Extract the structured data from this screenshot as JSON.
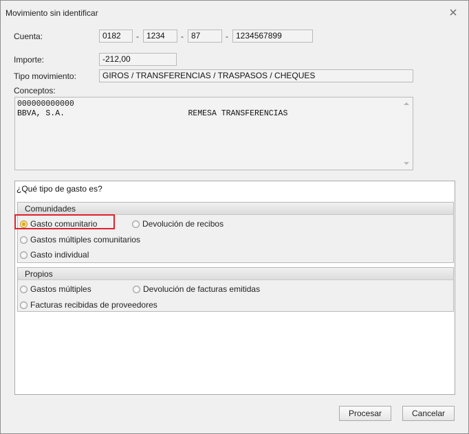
{
  "window": {
    "title": "Movimiento sin identificar"
  },
  "form": {
    "cuenta_label": "Cuenta:",
    "cuenta": [
      "0182",
      "1234",
      "87",
      "1234567899"
    ],
    "separator": "-",
    "importe_label": "Importe:",
    "importe": "-212,00",
    "tipo_label": "Tipo movimiento:",
    "tipo": "GIROS / TRANSFERENCIAS / TRASPASOS / CHEQUES",
    "conceptos_label": "Conceptos:",
    "conceptos_lines": [
      "000000000000",
      "BBVA, S.A.                          REMESA TRANSFERENCIAS"
    ]
  },
  "expense": {
    "question": "¿Qué tipo de gasto es?",
    "comunidades": {
      "title": "Comunidades",
      "options": [
        "Gasto comunitario",
        "Devolución de recibos",
        "Gastos múltiples comunitarios",
        "Gasto individual"
      ],
      "selected": "Gasto comunitario"
    },
    "propios": {
      "title": "Propios",
      "options": [
        "Gastos múltiples",
        "Devolución de facturas emitidas",
        "Facturas recibidas de proveedores"
      ]
    },
    "accent_color": "#e0a31a",
    "highlight_color": "#e0202a"
  },
  "buttons": {
    "procesar": "Procesar",
    "cancelar": "Cancelar"
  }
}
